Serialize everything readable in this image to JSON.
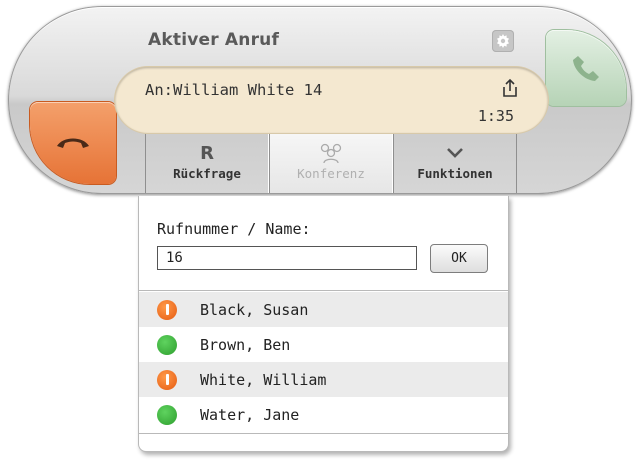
{
  "header": {
    "title": "Aktiver Anruf"
  },
  "display": {
    "caller": "An:William White 14",
    "duration": "1:35"
  },
  "tabs": [
    {
      "symbol": "R",
      "label": "Rückfrage",
      "active": false
    },
    {
      "label": "Konferenz",
      "active": true
    },
    {
      "label": "Funktionen",
      "active": false
    }
  ],
  "search": {
    "label": "Rufnummer / Name:",
    "value": "16",
    "ok_label": "OK"
  },
  "contacts": [
    {
      "name": "Black, Susan",
      "status": "busy"
    },
    {
      "name": "Brown, Ben",
      "status": "available"
    },
    {
      "name": "White, William",
      "status": "busy"
    },
    {
      "name": "Water, Jane",
      "status": "available"
    }
  ],
  "colors": {
    "hangup": "#e67336",
    "accept": "#b6d3b6",
    "display": "#f4e8d0",
    "busy": "#e55a10",
    "available": "#2e9e2e"
  },
  "icons": {
    "hangup": "phone-hangup-icon",
    "accept": "phone-accept-icon",
    "settings": "settings-icon",
    "share": "share-icon",
    "conference": "conference-icon",
    "functions": "chevron-down-icon"
  }
}
